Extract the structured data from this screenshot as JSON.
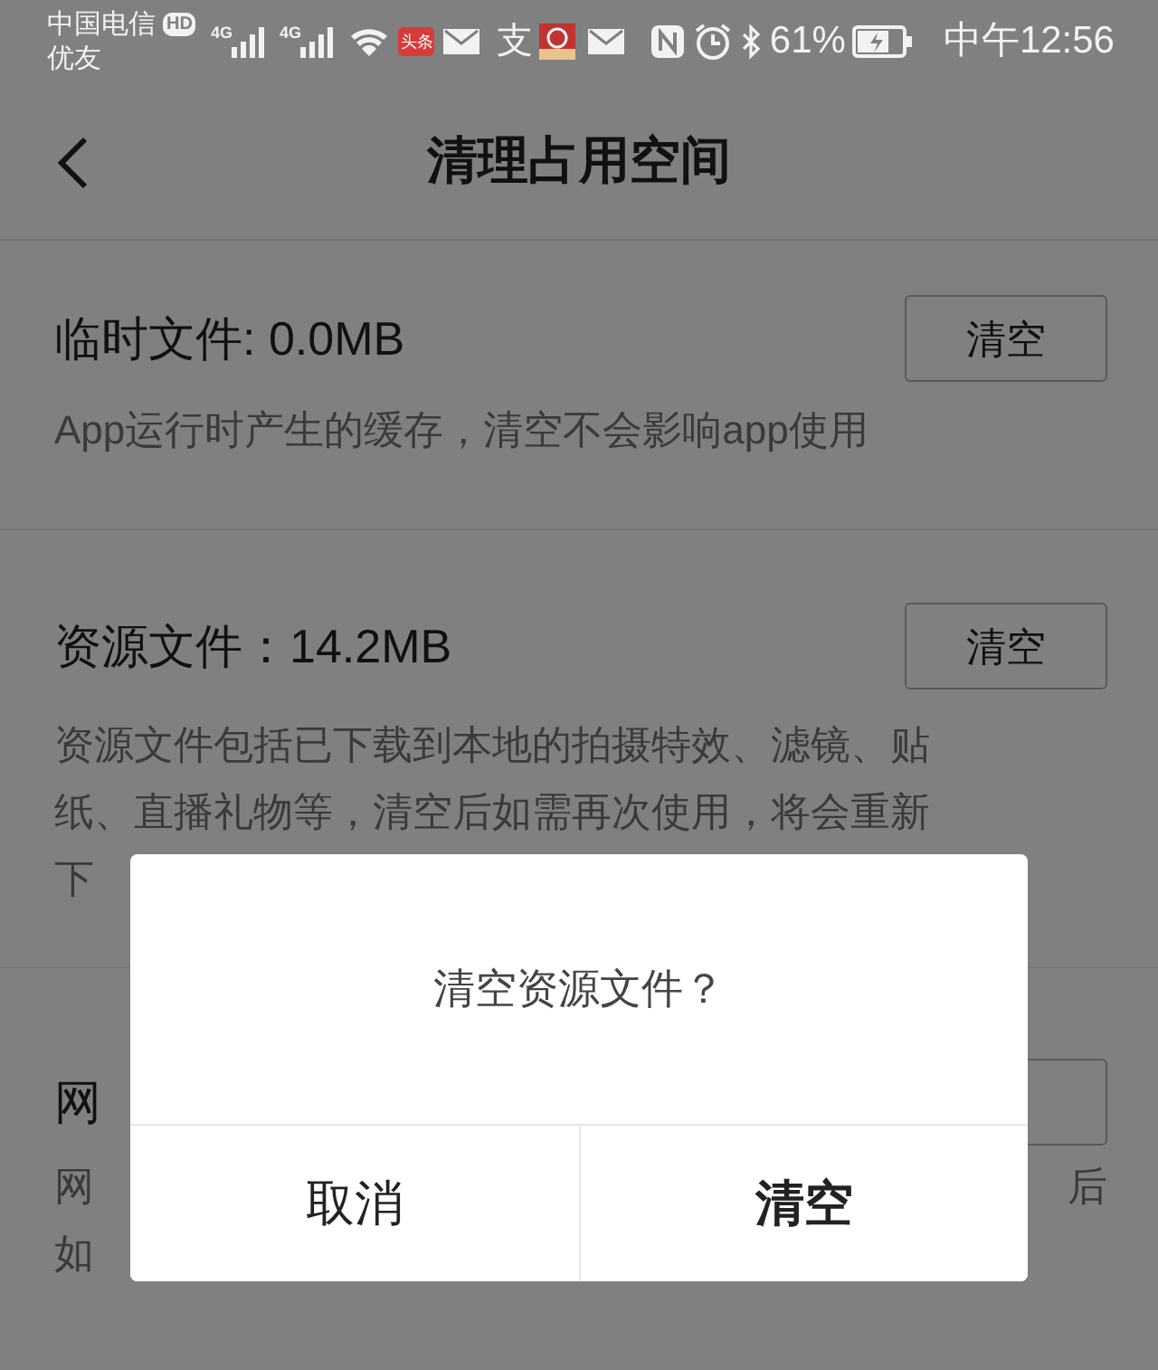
{
  "status_bar": {
    "carrier": "中国电信",
    "hd_badge": "HD",
    "carrier_2": "优友",
    "signal_labels": [
      "4G",
      "4G"
    ],
    "app_badge": "头条",
    "app_glyph": "支",
    "battery_percent": "61%",
    "time": "中午12:56"
  },
  "header": {
    "title": "清理占用空间"
  },
  "sections": [
    {
      "kind": "full",
      "title": "临时文件: 0.0MB",
      "button": "清空",
      "description_lines": [
        "App运行时产生的缓存，清空不会影响app使用"
      ]
    },
    {
      "kind": "full",
      "title": "资源文件：14.2MB",
      "button": "清空",
      "description_lines": [
        "资源文件包括已下载到本地的拍摄特效、滤镜、贴",
        "纸、直播礼物等，清空后如需再次使用，将会重新",
        "下"
      ]
    },
    {
      "kind": "covered",
      "title": "网",
      "description_left_lines": [
        "网",
        "如"
      ],
      "description_right_lines": [
        "后"
      ]
    }
  ],
  "dialog": {
    "message": "清空资源文件？",
    "buttons": [
      {
        "label": "取消",
        "kind": "cancel"
      },
      {
        "label": "清空",
        "kind": "confirm"
      }
    ]
  }
}
